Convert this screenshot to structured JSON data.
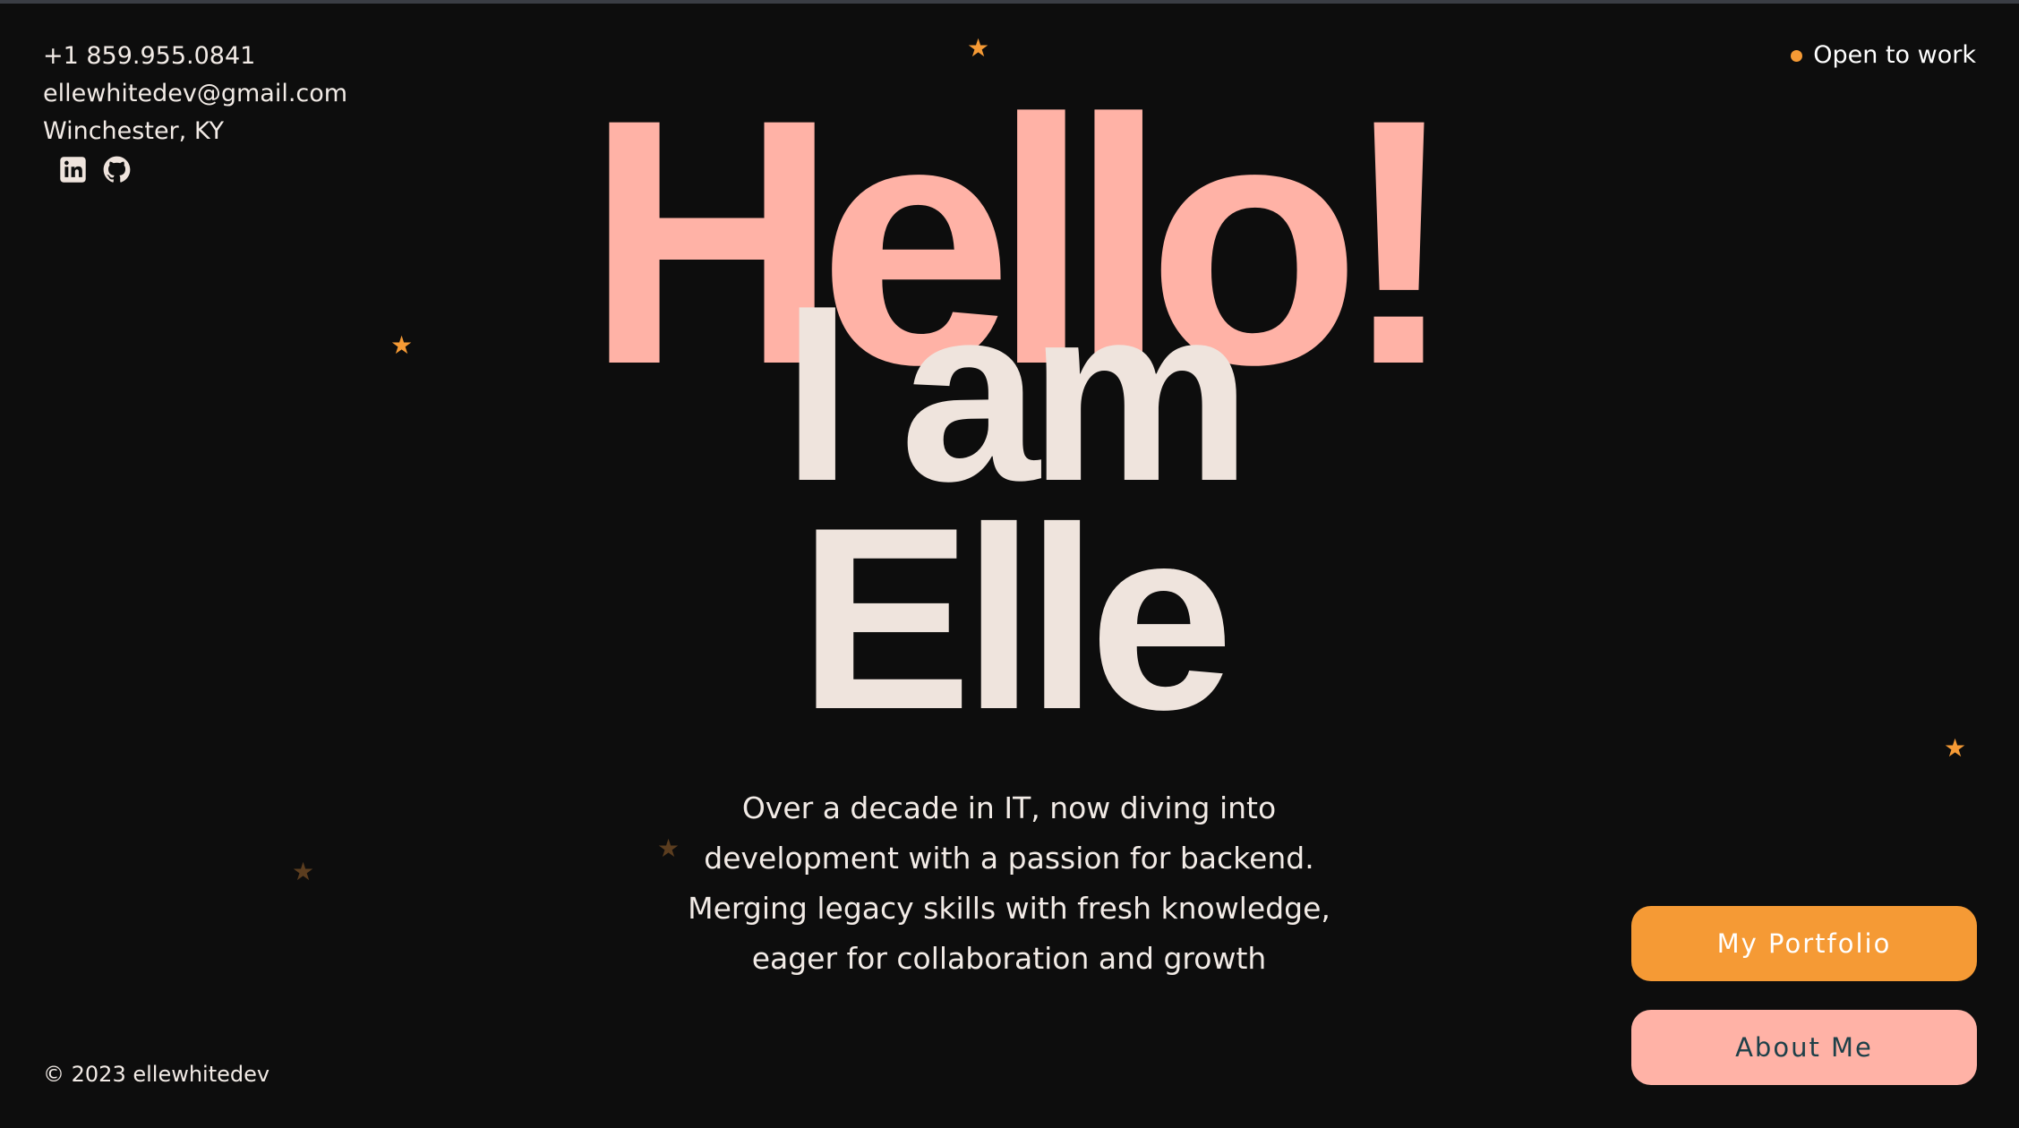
{
  "contact": {
    "phone": "+1 859.955.0841",
    "email": "ellewhitedev@gmail.com",
    "location": "Winchester, KY"
  },
  "status": {
    "label": "Open to work"
  },
  "hero": {
    "greeting": "Hello!",
    "intro": "I am",
    "name": "Elle"
  },
  "tagline": {
    "lines": [
      "Over a decade in IT, now diving into",
      "development with a passion for backend.",
      "Merging legacy skills with fresh knowledge,",
      "eager for collaboration and growth"
    ]
  },
  "buttons": {
    "portfolio": "My Portfolio",
    "about": "About Me"
  },
  "footer": {
    "copyright": "© 2023 ellewhitedev"
  },
  "icons": {
    "social": [
      "linkedin-icon",
      "github-icon"
    ],
    "decorative": "star-icon"
  },
  "colors": {
    "background": "#0d0d0d",
    "accent_orange": "#f59a35",
    "accent_pink": "#ffb2a6",
    "text_cream": "#efe4dd",
    "about_text": "#1e4049"
  }
}
